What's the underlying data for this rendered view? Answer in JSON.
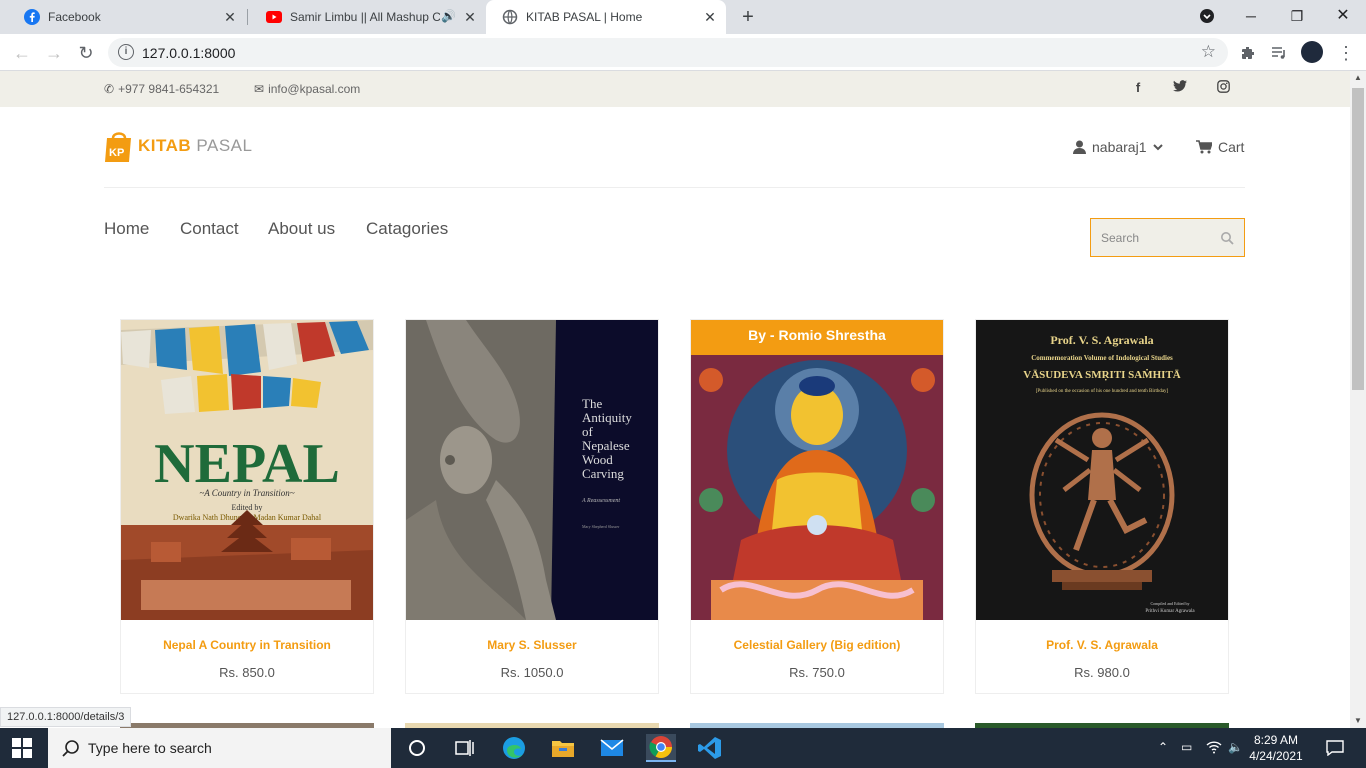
{
  "browser": {
    "tabs": [
      {
        "label": "Facebook",
        "active": false
      },
      {
        "label": "Samir Limbu || All Mashup Co",
        "active": false
      },
      {
        "label": "KITAB PASAL | Home",
        "active": true
      }
    ],
    "url": "127.0.0.1:8000",
    "status_url": "127.0.0.1:8000/details/3"
  },
  "topbar": {
    "phone": "+977 9841-654321",
    "email": "info@kpasal.com"
  },
  "header": {
    "logo_part1": "KITAB",
    "logo_part2": "PASAL",
    "logo_badge": "KP",
    "user": "nabaraj1",
    "cart": "Cart"
  },
  "nav": {
    "items": [
      "Home",
      "Contact",
      "About us",
      "Catagories"
    ],
    "search_placeholder": "Search"
  },
  "products": [
    {
      "title": "Nepal A Country in Transition",
      "price": "Rs. 850.0",
      "cover_text": [
        "NEPAL",
        "~A Country in Transition~",
        "Edited by",
        "Dwarika Nath Dhungel . Madan Kumar Dahal"
      ]
    },
    {
      "title": "Mary S. Slusser",
      "price": "Rs. 1050.0",
      "cover_text": [
        "The",
        "Antiquity",
        "of",
        "Nepalese",
        "Wood",
        "Carving",
        "A Reassessment",
        "Mary Shepherd Slusser"
      ]
    },
    {
      "title": "Celestial Gallery (Big edition)",
      "price": "Rs. 750.0",
      "ribbon": "By - Romio Shrestha"
    },
    {
      "title": "Prof. V. S. Agrawala",
      "price": "Rs. 980.0",
      "cover_text": [
        "Prof. V. S. Agrawala",
        "Commemoration Volume of Indological Studies",
        "VĀSUDEVA SMṚITI SAṀHITĀ",
        "[Published on the occasion of his one hundred and tenth Birthday]",
        "Compiled and Edited by",
        "Prithvi Kumar Agrawala"
      ]
    }
  ],
  "taskbar": {
    "search_placeholder": "Type here to search",
    "time": "8:29 AM",
    "date": "4/24/2021"
  },
  "colors": {
    "accent": "#f39c12",
    "topbar_bg": "#f0efe8",
    "taskbar_bg": "#1f2b3a"
  }
}
